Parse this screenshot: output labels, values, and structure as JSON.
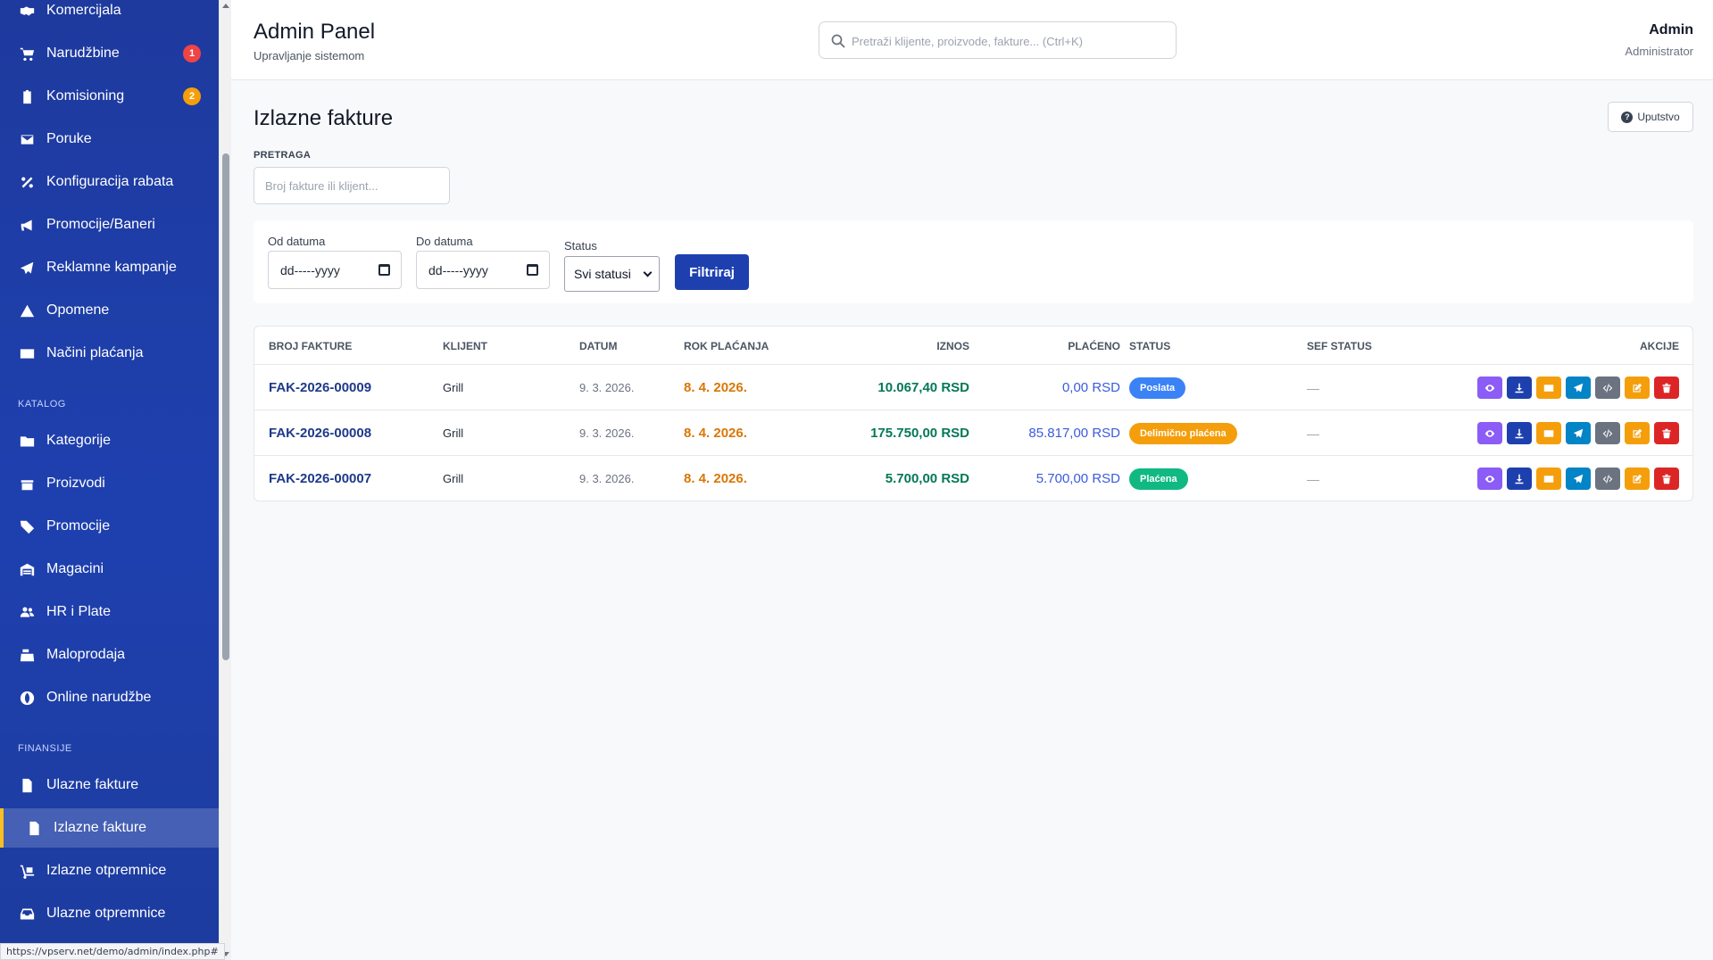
{
  "sidebar": {
    "items": [
      {
        "label": "Komercijala",
        "icon": "handshake-icon",
        "badge": ""
      },
      {
        "label": "Narudžbine",
        "icon": "cart-icon",
        "badge": "1",
        "badge_color": "#ef4444"
      },
      {
        "label": "Komisioning",
        "icon": "clipboard-icon",
        "badge": "2",
        "badge_color": "#f59e0b"
      },
      {
        "label": "Poruke",
        "icon": "envelope-icon",
        "badge": ""
      },
      {
        "label": "Konfiguracija rabata",
        "icon": "percent-icon",
        "badge": ""
      },
      {
        "label": "Promocije/Baneri",
        "icon": "megaphone-icon",
        "badge": ""
      },
      {
        "label": "Reklamne kampanje",
        "icon": "paper-plane-icon",
        "badge": ""
      },
      {
        "label": "Opomene",
        "icon": "warning-icon",
        "badge": ""
      },
      {
        "label": "Načini plaćanja",
        "icon": "credit-card-icon",
        "badge": ""
      }
    ],
    "section_katalog": "KATALOG",
    "katalog_items": [
      {
        "label": "Kategorije",
        "icon": "folder-icon"
      },
      {
        "label": "Proizvodi",
        "icon": "box-icon"
      },
      {
        "label": "Promocije",
        "icon": "tags-icon"
      },
      {
        "label": "Magacini",
        "icon": "warehouse-icon"
      },
      {
        "label": "HR i Plate",
        "icon": "users-icon"
      },
      {
        "label": "Maloprodaja",
        "icon": "cash-register-icon"
      },
      {
        "label": "Online narudžbe",
        "icon": "globe-icon"
      }
    ],
    "section_finansije": "FINANSIJE",
    "finansije_items": [
      {
        "label": "Ulazne fakture",
        "icon": "file-invoice-icon"
      },
      {
        "label": "Izlazne fakture",
        "icon": "file-invoice-dollar-icon",
        "active": true
      },
      {
        "label": "Izlazne otpremnice",
        "icon": "dolly-icon"
      },
      {
        "label": "Ulazne otpremnice",
        "icon": "inbox-icon"
      }
    ]
  },
  "status_bar_url": "https://vpserv.net/demo/admin/index.php#",
  "header": {
    "title": "Admin Panel",
    "subtitle": "Upravljanje sistemom",
    "search_placeholder": "Pretraži klijente, proizvode, fakture... (Ctrl+K)",
    "user_name": "Admin",
    "user_role": "Administrator"
  },
  "page": {
    "title": "Izlazne fakture",
    "help_label": "Uputstvo",
    "search_label": "PRETRAGA",
    "search_placeholder": "Broj fakture ili klijent..."
  },
  "filters": {
    "from_label": "Od datuma",
    "from_value": "dd-----yyyy",
    "to_label": "Do datuma",
    "to_value": "dd-----yyyy",
    "status_label": "Status",
    "status_value": "Svi statusi",
    "button": "Filtriraj"
  },
  "table": {
    "columns": [
      "BROJ FAKTURE",
      "KLIJENT",
      "DATUM",
      "ROK PLAĆANJA",
      "IZNOS",
      "PLAĆENO",
      "STATUS",
      "SEF STATUS",
      "AKCIJE"
    ],
    "rows": [
      {
        "number": "FAK-2026-00009",
        "client": "Grill",
        "date": "9. 3. 2026.",
        "due": "8. 4. 2026.",
        "amount": "10.067,40 RSD",
        "paid": "0,00 RSD",
        "status": "Poslata",
        "status_color": "#3b82f6",
        "sef": "—"
      },
      {
        "number": "FAK-2026-00008",
        "client": "Grill",
        "date": "9. 3. 2026.",
        "due": "8. 4. 2026.",
        "amount": "175.750,00 RSD",
        "paid": "85.817,00 RSD",
        "status": "Delimično plaćena",
        "status_color": "#f59e0b",
        "sef": "—"
      },
      {
        "number": "FAK-2026-00007",
        "client": "Grill",
        "date": "9. 3. 2026.",
        "due": "8. 4. 2026.",
        "amount": "5.700,00 RSD",
        "paid": "5.700,00 RSD",
        "status": "Plaćena",
        "status_color": "#10b981",
        "sef": "—"
      }
    ],
    "actions": [
      {
        "name": "view",
        "icon": "eye-icon",
        "color": "#8b5cf6"
      },
      {
        "name": "download",
        "icon": "download-icon",
        "color": "#1e40af"
      },
      {
        "name": "email",
        "icon": "envelope-icon",
        "color": "#f59e0b"
      },
      {
        "name": "send",
        "icon": "paper-plane-icon",
        "color": "#0284c7"
      },
      {
        "name": "xml",
        "icon": "code-icon",
        "color": "#6b7280"
      },
      {
        "name": "edit",
        "icon": "edit-icon",
        "color": "#f59e0b"
      },
      {
        "name": "delete",
        "icon": "trash-icon",
        "color": "#dc2626"
      }
    ]
  }
}
